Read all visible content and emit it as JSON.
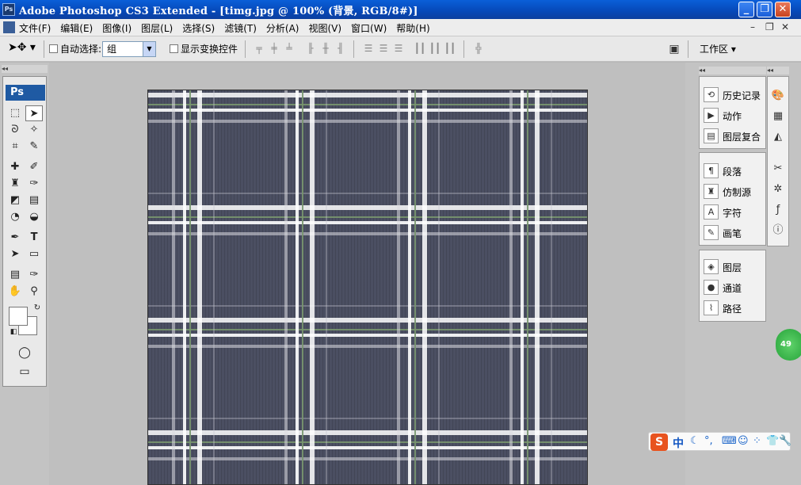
{
  "window": {
    "title": "Adobe Photoshop CS3 Extended - [timg.jpg @ 100% (背景, RGB/8#)]",
    "app_icon": "Ps"
  },
  "menu": {
    "items": [
      "文件(F)",
      "编辑(E)",
      "图像(I)",
      "图层(L)",
      "选择(S)",
      "滤镜(T)",
      "分析(A)",
      "视图(V)",
      "窗口(W)",
      "帮助(H)"
    ]
  },
  "options": {
    "auto_select_label": "自动选择:",
    "auto_select_value": "组",
    "show_transform_label": "显示变换控件",
    "workspace_label": "工作区 ▾"
  },
  "toolbox": {
    "logo": "Ps"
  },
  "panels": {
    "group1": [
      "历史记录",
      "动作",
      "图层复合"
    ],
    "group2": [
      "段落",
      "仿制源",
      "字符",
      "画笔"
    ],
    "group3": [
      "图层",
      "通道",
      "路径"
    ]
  },
  "badge": "49",
  "ime": {
    "logo": "S",
    "mode": "中"
  },
  "colors": {
    "titlebar": "#0648b8",
    "canvas_base": "#4b4f62",
    "ime_logo": "#e8531f"
  }
}
